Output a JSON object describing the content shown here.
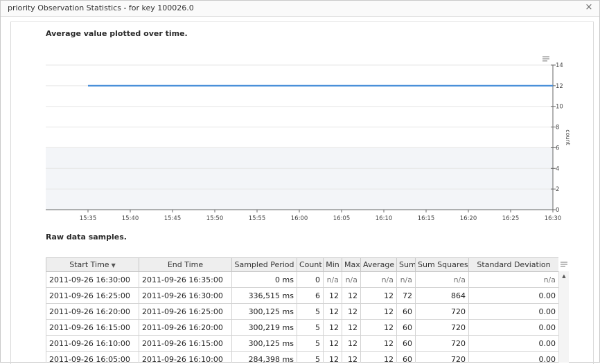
{
  "window": {
    "title": "priority Observation Statistics - for key 100026.0",
    "close_glyph": "×"
  },
  "chart_section": {
    "title": "Average value plotted over time."
  },
  "table_section": {
    "title": "Raw data samples."
  },
  "chart_data": {
    "type": "line",
    "title": "Average value plotted over time.",
    "xlabel": "",
    "ylabel": "count",
    "x_ticks": [
      "15:35",
      "15:40",
      "15:45",
      "15:50",
      "15:55",
      "16:00",
      "16:05",
      "16:10",
      "16:15",
      "16:20",
      "16:25",
      "16:30"
    ],
    "y_ticks": [
      0,
      2,
      4,
      6,
      8,
      10,
      12,
      14
    ],
    "ylim": [
      0,
      14
    ],
    "xlim": [
      "15:30",
      "16:30"
    ],
    "grid": true,
    "series": [
      {
        "x": [
          "15:35",
          "16:30"
        ],
        "values": [
          12,
          12
        ],
        "color": "#4a90d9"
      }
    ]
  },
  "table": {
    "sort_arrow": "▼",
    "columns": [
      "Start Time",
      "End Time",
      "Sampled Period",
      "Count",
      "Min",
      "Max",
      "Average",
      "Sum",
      "Sum Squares",
      "Standard Deviation"
    ],
    "rows": [
      [
        "2011-09-26 16:30:00",
        "2011-09-26 16:35:00",
        "0 ms",
        "0",
        "n/a",
        "n/a",
        "n/a",
        "n/a",
        "n/a",
        "n/a"
      ],
      [
        "2011-09-26 16:25:00",
        "2011-09-26 16:30:00",
        "336,515 ms",
        "6",
        "12",
        "12",
        "12",
        "72",
        "864",
        "0.00"
      ],
      [
        "2011-09-26 16:20:00",
        "2011-09-26 16:25:00",
        "300,125 ms",
        "5",
        "12",
        "12",
        "12",
        "60",
        "720",
        "0.00"
      ],
      [
        "2011-09-26 16:15:00",
        "2011-09-26 16:20:00",
        "300,219 ms",
        "5",
        "12",
        "12",
        "12",
        "60",
        "720",
        "0.00"
      ],
      [
        "2011-09-26 16:10:00",
        "2011-09-26 16:15:00",
        "300,125 ms",
        "5",
        "12",
        "12",
        "12",
        "60",
        "720",
        "0.00"
      ],
      [
        "2011-09-26 16:05:00",
        "2011-09-26 16:10:00",
        "284,398 ms",
        "5",
        "12",
        "12",
        "12",
        "60",
        "720",
        "0.00"
      ]
    ]
  },
  "colors": {
    "series_line": "#4a90d9",
    "plot_lower_band": "#f3f5f8",
    "gridline": "#e6e6e6",
    "na_text": "#777777"
  },
  "icons": {
    "chart_menu": "menu-lines-icon",
    "grid_menu": "menu-lines-icon",
    "close": "close-icon",
    "scroll_up": "arrow-up-icon"
  }
}
